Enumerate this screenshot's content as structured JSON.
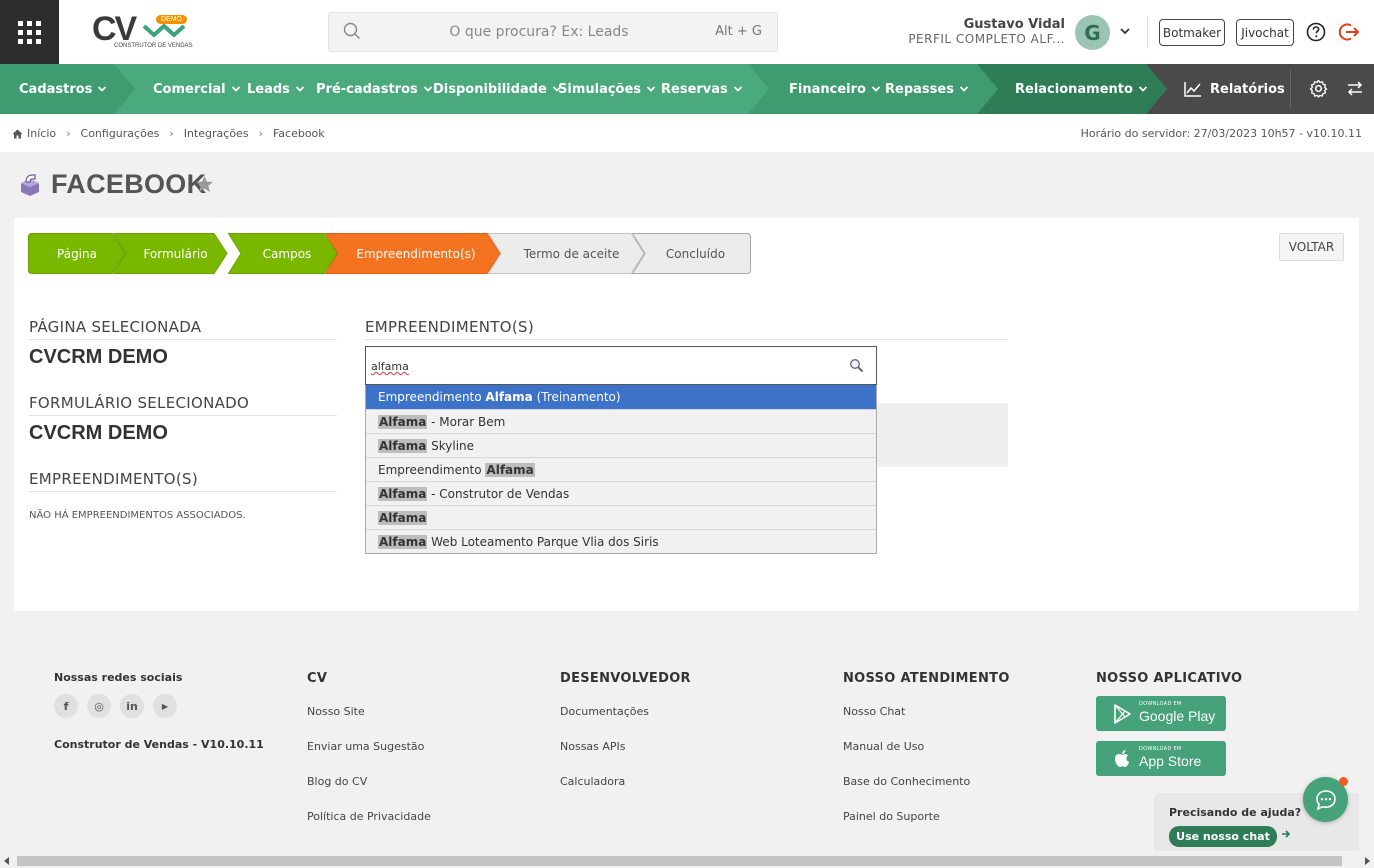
{
  "header": {
    "logo_text": "CV",
    "logo_badge": "DEMO",
    "logo_tagline": "CONSTRUTOR DE VENDAS",
    "search_placeholder": "O que procura? Ex: Leads",
    "search_shortcut": "Alt + G",
    "user_name": "Gustavo Vidal",
    "user_profile": "PERFIL COMPLETO ALF...",
    "avatar_letter": "G",
    "botmaker_label": "Botmaker",
    "jivochat_label": "Jivochat"
  },
  "nav": {
    "items": [
      {
        "label": "Cadastros"
      },
      {
        "label": "Comercial"
      },
      {
        "label": "Leads"
      },
      {
        "label": "Pré-cadastros"
      },
      {
        "label": "Disponibilidade"
      },
      {
        "label": "Simulações"
      },
      {
        "label": "Reservas"
      },
      {
        "label": "Financeiro"
      },
      {
        "label": "Repasses"
      },
      {
        "label": "Relacionamento"
      }
    ],
    "reports_label": "Relatórios"
  },
  "breadcrumb": {
    "items": [
      "Início",
      "Configurações",
      "Integrações",
      "Facebook"
    ],
    "server_time": "Horário do servidor: 27/03/2023 10h57 - v10.10.11"
  },
  "page": {
    "title": "FACEBOOK",
    "back_label": "VOLTAR"
  },
  "wizard": {
    "steps": [
      {
        "label": "Página",
        "state": "done"
      },
      {
        "label": "Formulário",
        "state": "done"
      },
      {
        "label": "Campos",
        "state": "done"
      },
      {
        "label": "Empreendimento(s)",
        "state": "active"
      },
      {
        "label": "Termo de aceite",
        "state": "todo"
      },
      {
        "label": "Concluído",
        "state": "todo"
      }
    ]
  },
  "summary": {
    "page_title": "PÁGINA SELECIONADA",
    "page_value": "CVCRM DEMO",
    "form_title": "FORMULÁRIO SELECIONADO",
    "form_value": "CVCRM DEMO",
    "ent_title": "EMPREENDIMENTO(S)",
    "ent_empty": "NÃO HÁ EMPREENDIMENTOS ASSOCIADOS."
  },
  "selector": {
    "title": "EMPREENDIMENTO(S)",
    "query": "alfama",
    "options": [
      {
        "before": "Empreendimento ",
        "match": "Alfama",
        "after": " (Treinamento)",
        "selected": true
      },
      {
        "before": "",
        "match": "Alfama",
        "after": " - Morar Bem",
        "selected": false
      },
      {
        "before": "",
        "match": "Alfama",
        "after": " Skyline",
        "selected": false
      },
      {
        "before": "Empreendimento ",
        "match": "Alfama",
        "after": "",
        "selected": false
      },
      {
        "before": "",
        "match": "Alfama",
        "after": " - Construtor de Vendas",
        "selected": false
      },
      {
        "before": "",
        "match": "Alfama",
        "after": "",
        "selected": false
      },
      {
        "before": "",
        "match": "Alfama",
        "after": " Web Loteamento Parque Vlia dos Siris",
        "selected": false
      }
    ]
  },
  "footer": {
    "social_title": "Nossas redes sociais",
    "social": [
      {
        "icon": "facebook-icon",
        "glyph": "f"
      },
      {
        "icon": "instagram-icon",
        "glyph": "◎"
      },
      {
        "icon": "linkedin-icon",
        "glyph": "in"
      },
      {
        "icon": "youtube-icon",
        "glyph": "▶"
      }
    ],
    "version": "Construtor de Vendas - V10.10.11",
    "cv_title": "CV",
    "cv_links": [
      "Nosso Site",
      "Enviar uma Sugestão",
      "Blog do CV",
      "Política de Privacidade"
    ],
    "dev_title": "DESENVOLVEDOR",
    "dev_links": [
      "Documentações",
      "Nossas APIs",
      "Calculadora"
    ],
    "support_title": "NOSSO ATENDIMENTO",
    "support_links": [
      "Nosso Chat",
      "Manual de Uso",
      "Base do Conhecimento",
      "Painel do Suporte"
    ],
    "app_title": "NOSSO APLICATIVO",
    "google_small": "DOWNLOAD EM",
    "google_big": "Google Play",
    "apple_small": "DOWNLOAD EM",
    "apple_big": "App Store"
  },
  "help": {
    "question": "Precisando de ajuda?",
    "button": "Use nosso chat"
  },
  "colors": {
    "nav_green": "#4aa97d",
    "step_green": "#7ab800",
    "step_orange": "#f37321",
    "select_blue": "#3d72c9",
    "brand_orange": "#f39200"
  }
}
